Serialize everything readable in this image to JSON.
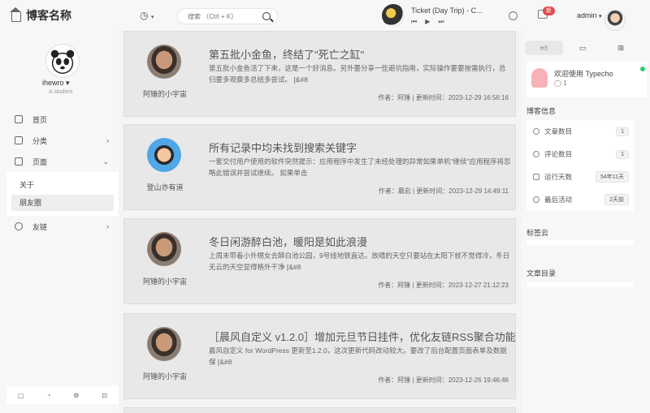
{
  "header": {
    "brand_title": "博客名称",
    "search_placeholder": "搜索 （Ctrl + K）",
    "music_title": "Ticket (Day Trip) - C...",
    "music_controls": [
      "⏮",
      "▶",
      "⏭"
    ],
    "notification_count": "新",
    "username": "admin"
  },
  "sidebar": {
    "name": "ihewro",
    "subtitle": "A student",
    "items": [
      {
        "label": "首页",
        "chevron": ""
      },
      {
        "label": "分类",
        "chevron": "›"
      },
      {
        "label": "页面",
        "chevron": "⌄"
      }
    ],
    "sub_items": [
      {
        "label": "关于"
      },
      {
        "label": "朋友圈"
      }
    ],
    "friends": {
      "label": "友链",
      "chevron": "›"
    }
  },
  "posts": [
    {
      "title": "第五批小金鱼，终结了\"死亡之缸\"",
      "excerpt": "第五批小金鱼活了下来，这是一个好消息。另外要分享一些避坑指南，实际操作要要按需执行，总归要多观察多总结多尝试。 [&#8",
      "author": "阿锤的小宇宙",
      "meta": "作者：阿锤 | 更新时间：2023-12-29 16:56:16",
      "avatar": "a"
    },
    {
      "title": "所有记录中均未找到搜索关键字",
      "excerpt": "一套交付用户使用的软件突然提示：应用程序中发生了未经处理的异常如果单机\"继续\"应用程序将忽略此错误并尝试继续。 如果单击",
      "author": "登山亦有道",
      "meta": "作者：晨岩 | 更新时间：2023-12-29 14:49:11",
      "avatar": "b"
    },
    {
      "title": "冬日闲游醉白池，暖阳是如此浪漫",
      "excerpt": "上周末带着小外甥女去醉白池公园，9号线地铁直达。放晴的天空只要站在太阳下就不觉得冷，冬日无云的天空显得格外干净 [&#8",
      "author": "阿锤的小宇宙",
      "meta": "作者：阿锤 | 更新时间：2023-12-27 21:12:23",
      "avatar": "a"
    },
    {
      "title": "［晨风自定义 v1.2.0］增加元旦节日挂件，优化友链RSS聚合功能",
      "excerpt": "晨风自定义 for WordPress 更新至1.2.0，这次更新代码改动较大。要改了后台配置页面表单及数据保 [&#8",
      "author": "阿锤的小宇宙",
      "meta": "作者：阿锤 | 更新时间：2023-12-26 19:46:46",
      "avatar": "a"
    }
  ],
  "right": {
    "welcome": "欢迎使用 Typecho",
    "welcome_count": "1",
    "blog_info_title": "博客信息",
    "stats": [
      {
        "label": "文章数目",
        "value": "1"
      },
      {
        "label": "评论数目",
        "value": "1"
      },
      {
        "label": "运行天数",
        "value": "54年11天"
      },
      {
        "label": "最后活动",
        "value": "2天前"
      }
    ],
    "tag_cloud_title": "标签云",
    "toc_title": "文章目录"
  }
}
